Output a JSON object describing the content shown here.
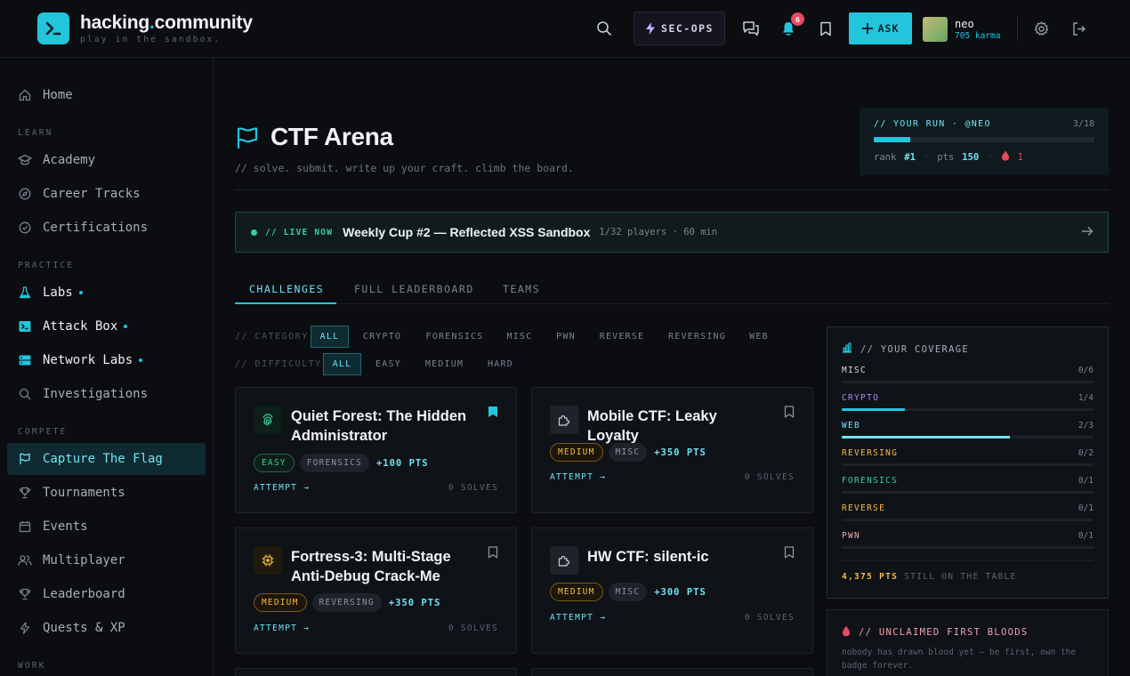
{
  "brand": {
    "name_main": "hacking",
    "name_dot": ".",
    "name_rest": "community",
    "tagline": "play in the sandbox."
  },
  "topbar": {
    "secops_label": "SEC-OPS",
    "notifications_count": "6",
    "ask_label": "ASK",
    "user_name": "neo",
    "user_karma": "705 karma"
  },
  "sidebar": {
    "home": "Home",
    "learn_section": "LEARN",
    "learn": [
      "Academy",
      "Career Tracks",
      "Certifications"
    ],
    "practice_section": "PRACTICE",
    "practice": [
      "Labs",
      "Attack Box",
      "Network Labs",
      "Investigations"
    ],
    "compete_section": "COMPETE",
    "compete": [
      "Capture The Flag",
      "Tournaments",
      "Events",
      "Multiplayer",
      "Leaderboard",
      "Quests & XP"
    ],
    "work_section": "WORK"
  },
  "header": {
    "title": "CTF Arena",
    "subtitle": "// solve. submit. write up your craft. climb the board."
  },
  "run": {
    "label": "// YOUR RUN · @NEO",
    "count": "3/18",
    "progress": 0.167,
    "rank_label": "rank",
    "rank": "#1",
    "pts_label": "pts",
    "pts": "150",
    "bloods": "1"
  },
  "live": {
    "label": "// LIVE NOW",
    "title": "Weekly Cup #2 — Reflected XSS Sandbox",
    "meta": "1/32 players · 60 min"
  },
  "tabs": [
    "CHALLENGES",
    "FULL LEADERBOARD",
    "TEAMS"
  ],
  "filters": {
    "category_label": "// CATEGORY",
    "categories": [
      "ALL",
      "CRYPTO",
      "FORENSICS",
      "MISC",
      "PWN",
      "REVERSE",
      "REVERSING",
      "WEB"
    ],
    "difficulty_label": "// DIFFICULTY",
    "difficulties": [
      "ALL",
      "EASY",
      "MEDIUM",
      "HARD"
    ]
  },
  "challenges": [
    {
      "title": "Quiet Forest: The Hidden Administrator",
      "difficulty": "EASY",
      "category": "FORENSICS",
      "points": "+100 PTS",
      "attempt": "ATTEMPT →",
      "solves": "0 SOLVES",
      "bookmarked": true
    },
    {
      "title": "Mobile CTF: Leaky Loyalty",
      "difficulty": "MEDIUM",
      "category": "MISC",
      "points": "+350 PTS",
      "attempt": "ATTEMPT →",
      "solves": "0 SOLVES",
      "bookmarked": false
    },
    {
      "title": "Fortress-3: Multi-Stage Anti-Debug Crack-Me",
      "difficulty": "MEDIUM",
      "category": "REVERSING",
      "points": "+350 PTS",
      "attempt": "ATTEMPT →",
      "solves": "0 SOLVES",
      "bookmarked": false
    },
    {
      "title": "HW CTF: silent-ic",
      "difficulty": "MEDIUM",
      "category": "MISC",
      "points": "+300 PTS",
      "attempt": "ATTEMPT →",
      "solves": "0 SOLVES",
      "bookmarked": false
    }
  ],
  "coverage": {
    "title": "// YOUR COVERAGE",
    "rows": [
      {
        "name": "MISC",
        "count": "0/6",
        "fraction": 0,
        "color": "#d7dbe0"
      },
      {
        "name": "CRYPTO",
        "count": "1/4",
        "fraction": 0.25,
        "color": "#a78bfa"
      },
      {
        "name": "WEB",
        "count": "2/3",
        "fraction": 0.667,
        "color": "#6fe3f2"
      },
      {
        "name": "REVERSING",
        "count": "0/2",
        "fraction": 0,
        "color": "#f5b942"
      },
      {
        "name": "FORENSICS",
        "count": "0/1",
        "fraction": 0,
        "color": "#34d399"
      },
      {
        "name": "REVERSE",
        "count": "0/1",
        "fraction": 0,
        "color": "#f5b942"
      },
      {
        "name": "PWN",
        "count": "0/1",
        "fraction": 0,
        "color": "#f0a2ad"
      }
    ],
    "footer_pts": "4,375 PTS",
    "footer_text": "STILL ON THE TABLE"
  },
  "first_bloods": {
    "title": "// UNCLAIMED FIRST BLOODS",
    "text": "nobody has drawn blood yet — be first, own the badge forever."
  },
  "colors": {
    "accent": "#22c5dc",
    "live": "#34d399",
    "danger": "#e84a5f",
    "medium": "#f5b942"
  }
}
